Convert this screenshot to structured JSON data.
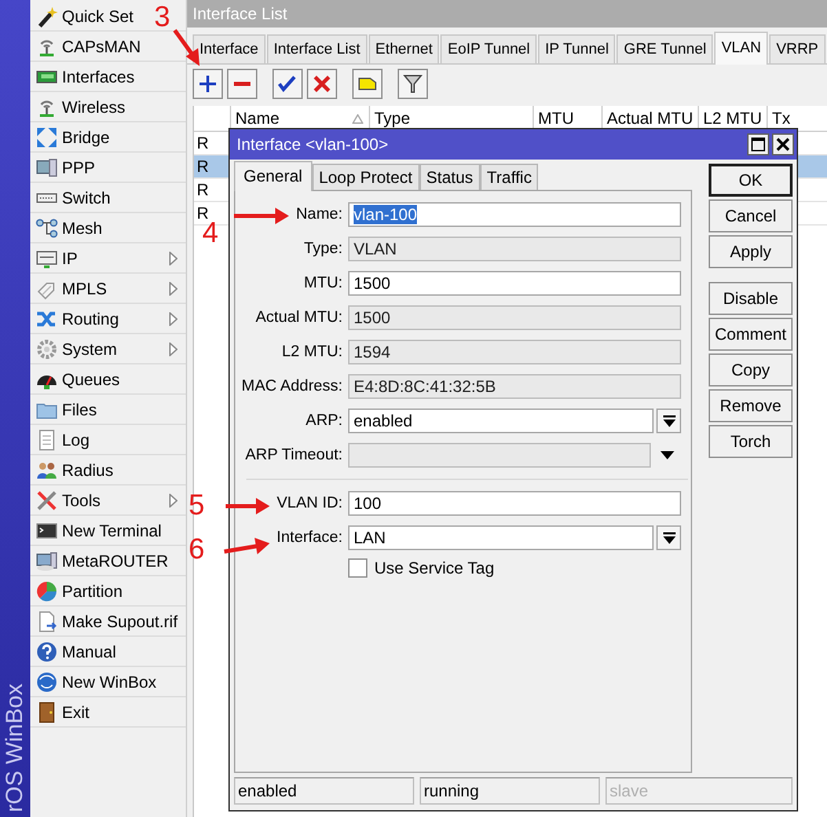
{
  "side_banner": {
    "text": "rOS WinBox"
  },
  "sidebar": {
    "items": [
      {
        "label": "Quick Set",
        "submenu": false
      },
      {
        "label": "CAPsMAN",
        "submenu": false
      },
      {
        "label": "Interfaces",
        "submenu": false
      },
      {
        "label": "Wireless",
        "submenu": false
      },
      {
        "label": "Bridge",
        "submenu": false
      },
      {
        "label": "PPP",
        "submenu": false
      },
      {
        "label": "Switch",
        "submenu": false
      },
      {
        "label": "Mesh",
        "submenu": false
      },
      {
        "label": "IP",
        "submenu": true
      },
      {
        "label": "MPLS",
        "submenu": true
      },
      {
        "label": "Routing",
        "submenu": true
      },
      {
        "label": "System",
        "submenu": true
      },
      {
        "label": "Queues",
        "submenu": false
      },
      {
        "label": "Files",
        "submenu": false
      },
      {
        "label": "Log",
        "submenu": false
      },
      {
        "label": "Radius",
        "submenu": false
      },
      {
        "label": "Tools",
        "submenu": true
      },
      {
        "label": "New Terminal",
        "submenu": false
      },
      {
        "label": "MetaROUTER",
        "submenu": false
      },
      {
        "label": "Partition",
        "submenu": false
      },
      {
        "label": "Make Supout.rif",
        "submenu": false
      },
      {
        "label": "Manual",
        "submenu": false
      },
      {
        "label": "New WinBox",
        "submenu": false
      },
      {
        "label": "Exit",
        "submenu": false
      }
    ]
  },
  "window": {
    "title": "Interface List",
    "tabs": [
      {
        "label": "Interface",
        "selected": false
      },
      {
        "label": "Interface List",
        "selected": false
      },
      {
        "label": "Ethernet",
        "selected": false
      },
      {
        "label": "EoIP Tunnel",
        "selected": false
      },
      {
        "label": "IP Tunnel",
        "selected": false
      },
      {
        "label": "GRE Tunnel",
        "selected": false
      },
      {
        "label": "VLAN",
        "selected": true
      },
      {
        "label": "VRRP",
        "selected": false
      }
    ],
    "toolbar": [
      {
        "kind": "add"
      },
      {
        "kind": "remove"
      },
      {
        "kind": "enable"
      },
      {
        "kind": "disable"
      },
      {
        "kind": "comment"
      },
      {
        "kind": "filter"
      }
    ],
    "table": {
      "columns": [
        {
          "label": "Name",
          "sorted": true
        },
        {
          "label": "Type",
          "sorted": false
        },
        {
          "label": "MTU",
          "sorted": false
        },
        {
          "label": "Actual MTU",
          "sorted": false
        },
        {
          "label": "L2 MTU",
          "sorted": false
        },
        {
          "label": "Tx",
          "sorted": false
        }
      ],
      "rows": [
        {
          "flag": "R",
          "selected": false
        },
        {
          "flag": "R",
          "selected": true
        },
        {
          "flag": "R",
          "selected": false
        },
        {
          "flag": "R",
          "selected": false
        }
      ]
    }
  },
  "dialog": {
    "title": "Interface <vlan-100>",
    "tabs": [
      {
        "label": "General",
        "selected": true
      },
      {
        "label": "Loop Protect",
        "selected": false
      },
      {
        "label": "Status",
        "selected": false
      },
      {
        "label": "Traffic",
        "selected": false
      }
    ],
    "fields": [
      {
        "kind": "text",
        "label": "Name:",
        "value": "vlan-100",
        "read_only": false,
        "text_selected": true
      },
      {
        "kind": "text",
        "label": "Type:",
        "value": "VLAN",
        "read_only": true,
        "text_selected": false
      },
      {
        "kind": "text",
        "label": "MTU:",
        "value": "1500",
        "read_only": false,
        "text_selected": false
      },
      {
        "kind": "text",
        "label": "Actual MTU:",
        "value": "1500",
        "read_only": true,
        "text_selected": false
      },
      {
        "kind": "text",
        "label": "L2 MTU:",
        "value": "1594",
        "read_only": true,
        "text_selected": false
      },
      {
        "kind": "text",
        "label": "MAC Address:",
        "value": "E4:8D:8C:41:32:5B",
        "read_only": true,
        "text_selected": false
      },
      {
        "kind": "dropdown",
        "label": "ARP:",
        "value": "enabled",
        "read_only": false,
        "text_selected": false
      },
      {
        "kind": "combo",
        "label": "ARP Timeout:",
        "read_only": true
      }
    ],
    "vlan_fields": [
      {
        "kind": "text",
        "label": "VLAN ID:",
        "value": "100",
        "read_only": false,
        "text_selected": false
      },
      {
        "kind": "dropdown",
        "label": "Interface:",
        "value": "LAN",
        "read_only": false,
        "text_selected": false
      }
    ],
    "checkbox": {
      "label": "Use Service Tag",
      "checked": false
    },
    "buttons": [
      {
        "label": "OK",
        "default": true
      },
      {
        "label": "Cancel",
        "default": false
      },
      {
        "label": "Apply",
        "default": false
      }
    ],
    "actions": [
      {
        "label": "Disable"
      },
      {
        "label": "Comment"
      },
      {
        "label": "Copy"
      },
      {
        "label": "Remove"
      },
      {
        "label": "Torch"
      }
    ],
    "status_bar": [
      {
        "text": "enabled",
        "disabled": false
      },
      {
        "text": "running",
        "disabled": false
      },
      {
        "text": "slave",
        "disabled": true
      }
    ]
  },
  "annotations": [
    {
      "label": "3"
    },
    {
      "label": "4"
    },
    {
      "label": "5"
    },
    {
      "label": "6"
    }
  ]
}
